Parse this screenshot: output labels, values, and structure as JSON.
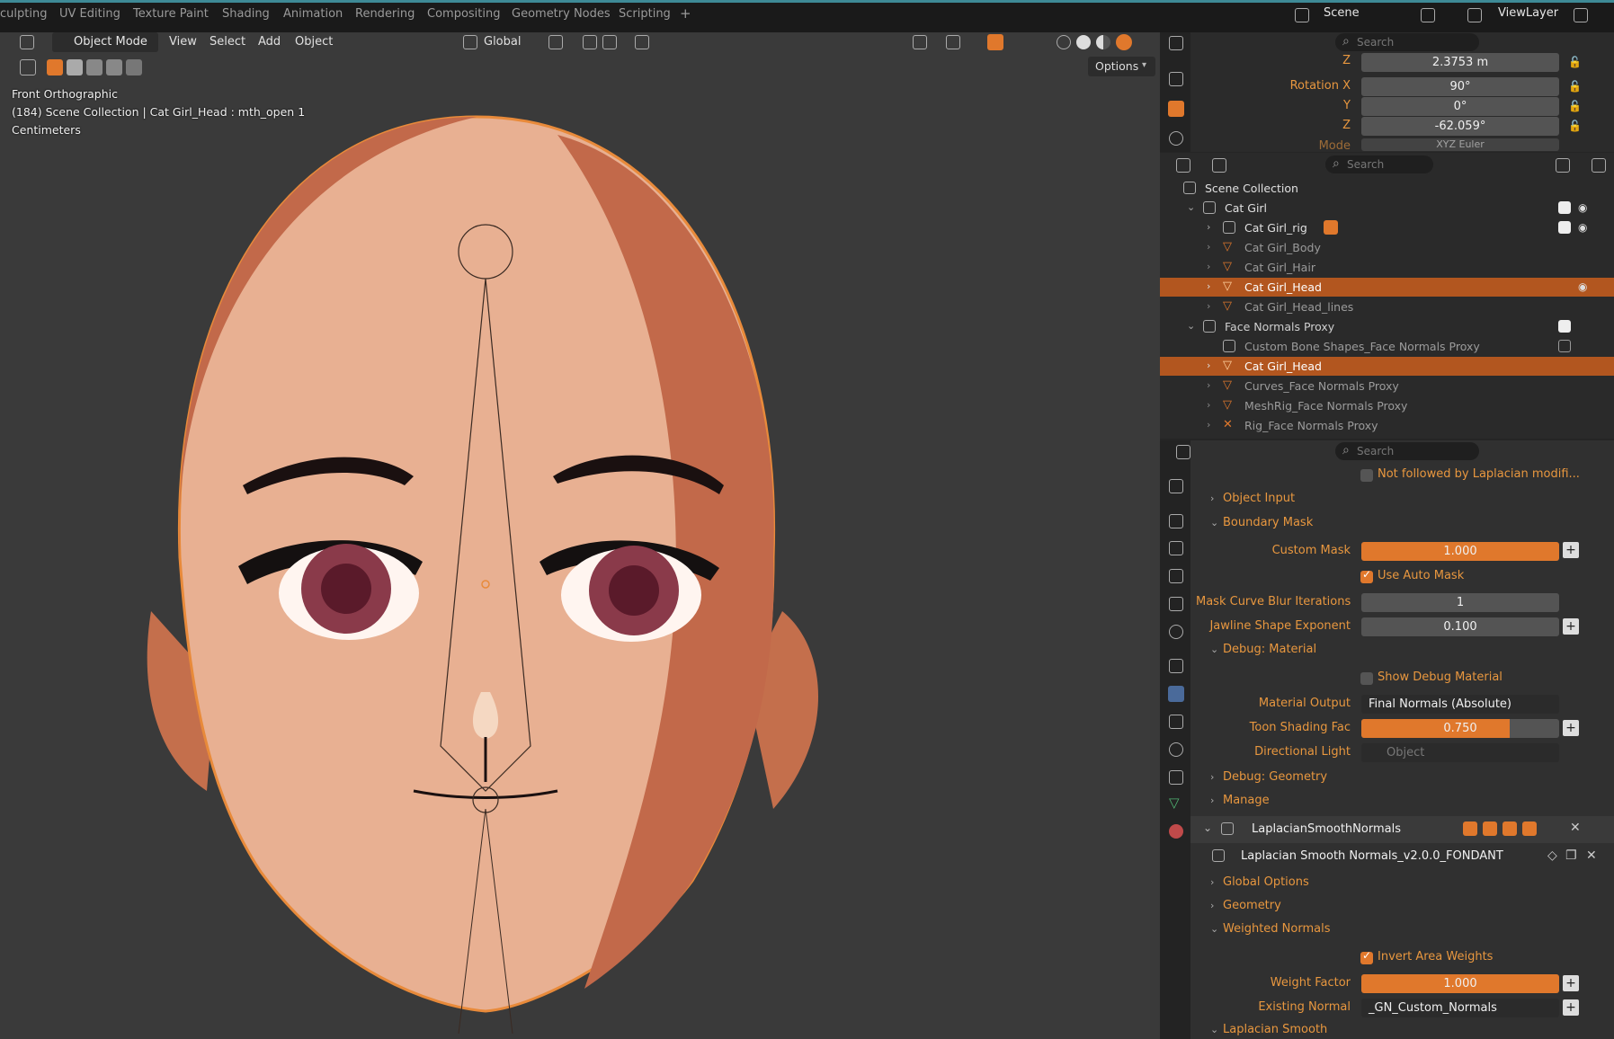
{
  "topbar": {
    "tabs": [
      "culpting",
      "UV Editing",
      "Texture Paint",
      "Shading",
      "Animation",
      "Rendering",
      "Compositing",
      "Geometry Nodes",
      "Scripting",
      "+"
    ],
    "scene_label": "Scene",
    "viewlayer_label": "ViewLayer"
  },
  "viewport": {
    "mode_label": "Object Mode",
    "menus": [
      "View",
      "Select",
      "Add",
      "Object"
    ],
    "transform_orientation": "Global",
    "options_label": "Options",
    "overlay": {
      "view_name": "Front Orthographic",
      "collection_path": "(184) Scene Collection | Cat Girl_Head : mth_open 1",
      "units": "Centimeters"
    }
  },
  "transform_panel": {
    "search_placeholder": "Search",
    "z_label": "Z",
    "z_value": "2.3753 m",
    "rotation_label": "Rotation X",
    "rot_x": "90°",
    "y_label": "Y",
    "rot_y": "0°",
    "z2_label": "Z",
    "rot_z": "-62.059°",
    "mode_label": "Mode",
    "mode_value": "XYZ Euler"
  },
  "outliner": {
    "search_placeholder": "Search",
    "rows": [
      {
        "label": "Scene Collection"
      },
      {
        "label": "Cat Girl"
      },
      {
        "label": "Cat Girl_rig"
      },
      {
        "label": "Cat Girl_Body"
      },
      {
        "label": "Cat Girl_Hair"
      },
      {
        "label": "Cat Girl_Head"
      },
      {
        "label": "Cat Girl_Head_lines"
      },
      {
        "label": "Face Normals Proxy"
      },
      {
        "label": "Custom Bone Shapes_Face Normals Proxy"
      },
      {
        "label": "Cat Girl_Head"
      },
      {
        "label": "Curves_Face Normals Proxy"
      },
      {
        "label": "MeshRig_Face Normals Proxy"
      },
      {
        "label": "Rig_Face Normals Proxy"
      }
    ]
  },
  "properties": {
    "search_placeholder": "Search",
    "not_followed": "Not followed by Laplacian modifi...",
    "object_input": "Object Input",
    "boundary_mask": "Boundary Mask",
    "custom_mask_label": "Custom Mask",
    "custom_mask_value": "1.000",
    "use_auto_mask": "Use Auto Mask",
    "mask_curve_label": "Mask Curve Blur Iterations",
    "mask_curve_value": "1",
    "jawline_label": "Jawline Shape Exponent",
    "jawline_value": "0.100",
    "debug_material": "Debug: Material",
    "show_debug_material": "Show Debug Material",
    "material_output_label": "Material Output",
    "material_output_value": "Final Normals (Absolute)",
    "toon_label": "Toon Shading Fac",
    "toon_value": "0.750",
    "toon_fraction": 0.75,
    "dir_light_label": "Directional Light",
    "dir_light_placeholder": "Object",
    "debug_geometry": "Debug: Geometry",
    "manage": "Manage",
    "modifier_name": "LaplacianSmoothNormals",
    "node_group": "Laplacian Smooth Normals_v2.0.0_FONDANT",
    "global_options": "Global Options",
    "geometry": "Geometry",
    "weighted_normals": "Weighted Normals",
    "invert_area_weights": "Invert Area Weights",
    "weight_factor_label": "Weight Factor",
    "weight_factor_value": "1.000",
    "existing_normal_label": "Existing Normal",
    "existing_normal_value": "_GN_Custom_Normals",
    "laplacian_smooth": "Laplacian Smooth"
  },
  "colors": {
    "accent_orange": "#e0782c",
    "label_orange": "#e8973f",
    "selected_row": "#b2561f",
    "viewport_bg": "#3a3a3a"
  }
}
